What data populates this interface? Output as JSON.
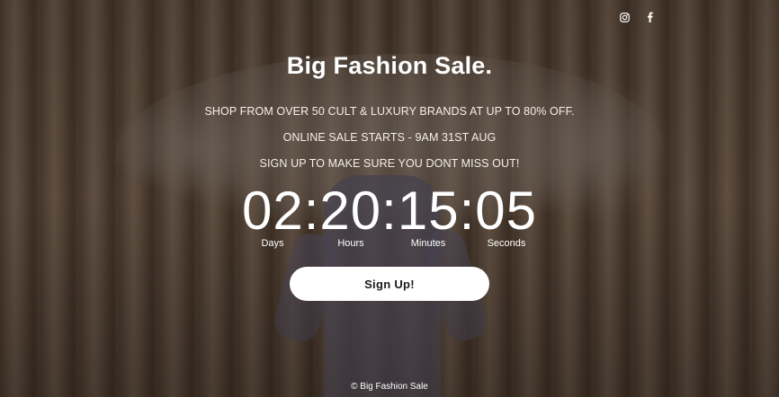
{
  "header": {
    "social": [
      {
        "icon": "instagram-icon"
      },
      {
        "icon": "facebook-icon"
      }
    ]
  },
  "hero": {
    "title": "Big Fashion Sale.",
    "line1": "SHOP FROM OVER 50 CULT & LUXURY BRANDS AT UP TO 80% OFF.",
    "line2": "ONLINE SALE STARTS - 9AM 31ST AUG",
    "line3": "SIGN UP TO MAKE SURE YOU DONT MISS OUT!"
  },
  "countdown": {
    "display": "02:20:15:05",
    "labels": {
      "days": "Days",
      "hours": "Hours",
      "minutes": "Minutes",
      "seconds": "Seconds"
    }
  },
  "cta": {
    "signup_label": "Sign Up!"
  },
  "footer": {
    "copyright": "© Big Fashion Sale"
  },
  "colors": {
    "text": "#ffffff",
    "button_bg": "#ffffff",
    "button_text": "#1b1b1b",
    "curtain": "#8a7260"
  }
}
